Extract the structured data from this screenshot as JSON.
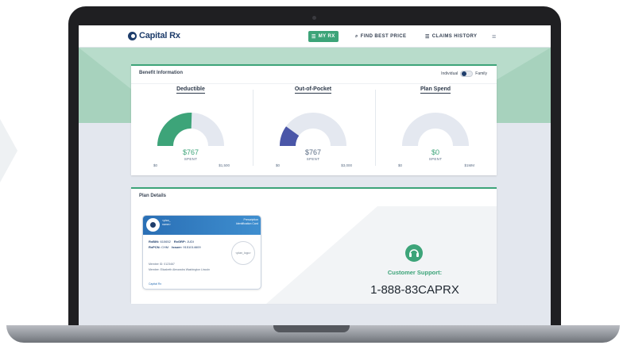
{
  "nav": {
    "logo": "Capital Rx",
    "my_rx": "MY RX",
    "find_best_price": "FIND BEST PRICE",
    "claims_history": "CLAIMS HISTORY",
    "menu_icon": "menu-icon"
  },
  "benefit": {
    "title": "Benefit Information",
    "toggle_left": "Individual",
    "toggle_right": "Family",
    "gauges": [
      {
        "title": "Deductible",
        "amount": "$767",
        "spent_label": "SPENT",
        "min": "$0",
        "max": "$1,500",
        "fill_fraction": 0.51,
        "fill_color": "#3da479",
        "amount_color": "#3da479"
      },
      {
        "title": "Out-of-Pocket",
        "amount": "$767",
        "spent_label": "SPENT",
        "min": "$0",
        "max": "$3,000",
        "fill_fraction": 0.2,
        "fill_color": "#4a56a8",
        "amount_color": "#5b6d85"
      },
      {
        "title": "Plan Spend",
        "amount": "$0",
        "spent_label": "SPENT",
        "min": "$0",
        "max": "$1MM",
        "fill_fraction": 0.0,
        "fill_color": "#3da479",
        "amount_color": "#3da479"
      }
    ]
  },
  "plan": {
    "title": "Plan Details",
    "card": {
      "member_first": "<plan_",
      "member_second": "name>",
      "rx_line1": "Prescription",
      "rx_line2": "Identification Card",
      "rxbin_label": "RxBIN:",
      "rxbin_value": "610652",
      "rxgrp_label": "RxGRP:",
      "rxgrp_value": "JUDI",
      "rxpcn_label": "RxPCN:",
      "rxpcn_value": "CHM",
      "issuer_label": "Issuer:",
      "issuer_value": "9151014609",
      "logo_placeholder": "<plan_logo>",
      "member_id": "Member ID: 0123467",
      "member_name": "Member: Elizabeth Alexandra Washington Lincoln",
      "footer": "Capital Rx"
    },
    "support_label": "Customer Support:",
    "support_phone": "1-888-83CAPRX"
  }
}
